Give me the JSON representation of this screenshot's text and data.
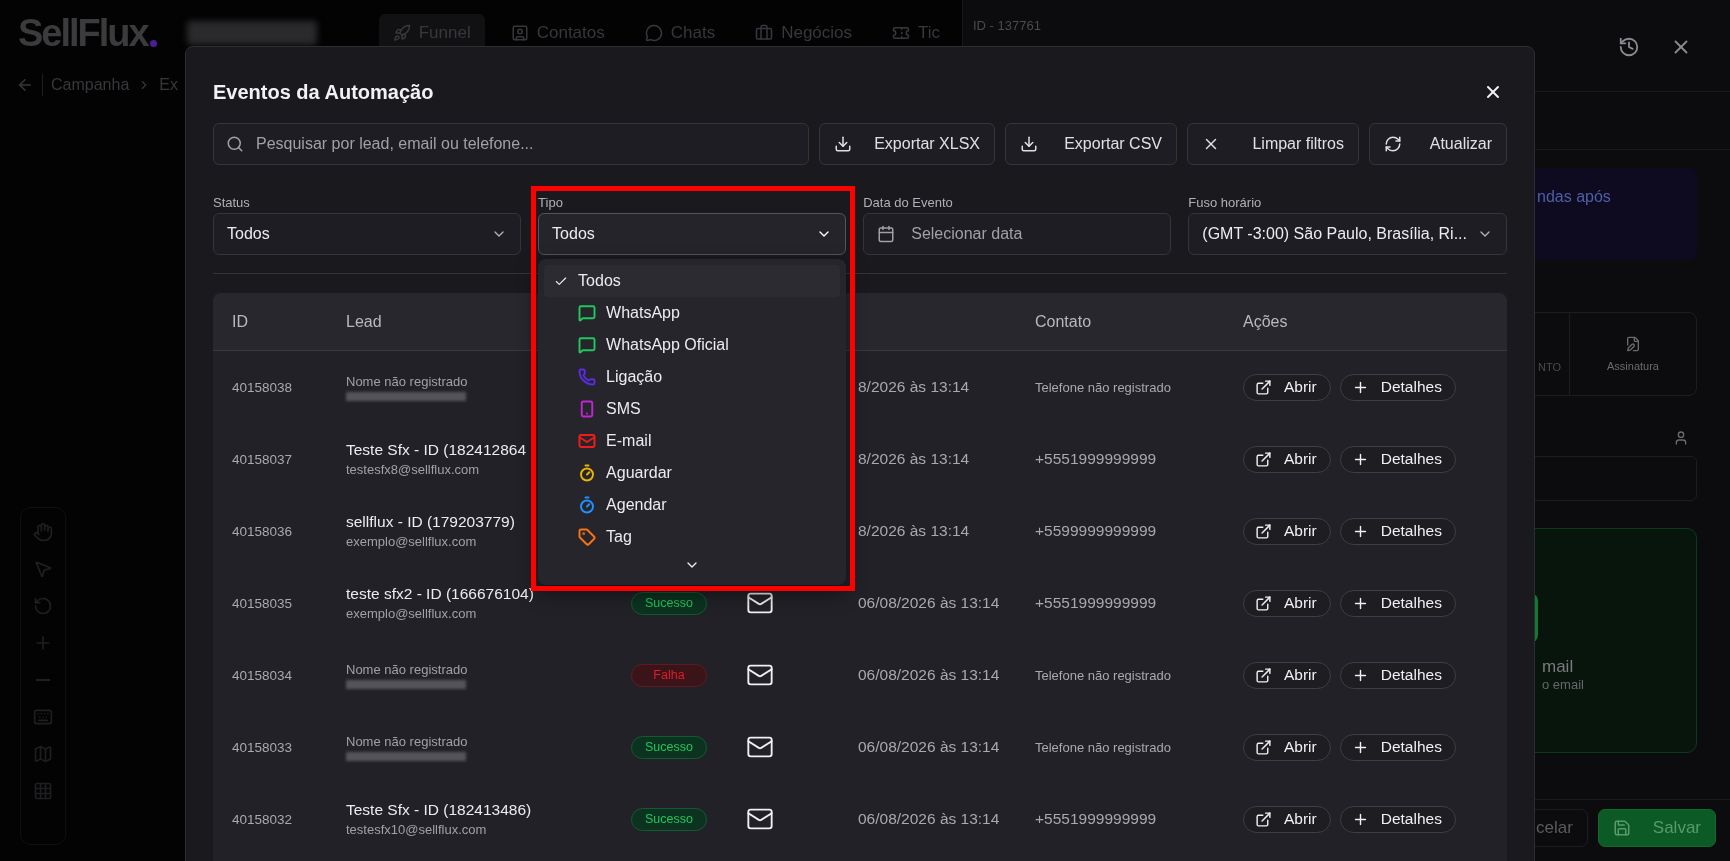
{
  "app": {
    "logo": "SellFlux",
    "nav": [
      {
        "label": "Funnel",
        "selected": true,
        "kind": "funnel"
      },
      {
        "label": "Contatos",
        "selected": false,
        "kind": "contacts"
      },
      {
        "label": "Chats",
        "selected": false,
        "kind": "chats"
      },
      {
        "label": "Negócios",
        "selected": false,
        "kind": "deals"
      },
      {
        "label": "Tic",
        "selected": false,
        "kind": "tickets"
      }
    ],
    "breadcrumb": [
      "Campanha",
      "Ex"
    ]
  },
  "side_panel": {
    "id_label": "ID - 137761",
    "banner_text": "ndas após",
    "option_cards": [
      "NTO",
      "Assinatura"
    ],
    "email_card": {
      "title": "mail",
      "subtitle": "o email"
    },
    "buttons": [
      {
        "label": "celar",
        "kind": "secondary"
      },
      {
        "label": "Salvar",
        "kind": "primary"
      }
    ]
  },
  "modal": {
    "title": "Eventos da Automação",
    "search": {
      "placeholder": "Pesquisar por lead, email ou telefone..."
    },
    "actions": [
      {
        "label": "Exportar XLSX",
        "kind": "download"
      },
      {
        "label": "Exportar CSV",
        "kind": "download"
      },
      {
        "label": "Limpar filtros",
        "kind": "clear"
      },
      {
        "label": "Atualizar",
        "kind": "refresh"
      }
    ],
    "filters": [
      {
        "label": "Status",
        "kind": "select",
        "value": "Todos",
        "expanded": false
      },
      {
        "label": "Tipo",
        "kind": "select",
        "value": "Todos",
        "expanded": true
      },
      {
        "label": "Data do Evento",
        "kind": "date",
        "placeholder": "Selecionar data"
      },
      {
        "label": "Fuso horário",
        "kind": "select",
        "value": "(GMT -3:00) São Paulo, Brasília, Ri...",
        "expanded": false
      }
    ],
    "type_menu": [
      {
        "label": "Todos",
        "kind": "all",
        "selected": true
      },
      {
        "label": "WhatsApp",
        "kind": "chat",
        "selected": false,
        "color": "#22c55e"
      },
      {
        "label": "WhatsApp Oficial",
        "kind": "chat",
        "selected": false,
        "color": "#22c55e"
      },
      {
        "label": "Ligação",
        "kind": "phone",
        "selected": false,
        "color": "#5b2be0"
      },
      {
        "label": "SMS",
        "kind": "sms",
        "selected": false,
        "color": "#c026d3"
      },
      {
        "label": "E-mail",
        "kind": "email",
        "selected": false,
        "color": "#ef1c1c"
      },
      {
        "label": "Aguardar",
        "kind": "wait",
        "selected": false,
        "color": "#eab308"
      },
      {
        "label": "Agendar",
        "kind": "schedule",
        "selected": false,
        "color": "#1e90ff"
      },
      {
        "label": "Tag",
        "kind": "tag",
        "selected": false,
        "color": "#f97316"
      }
    ],
    "table": {
      "header": {
        "id": "ID",
        "lead": "Lead",
        "contact": "Contato",
        "actions": "Ações"
      },
      "rows": [
        {
          "id": "40158038",
          "lead": "Nome não registrado",
          "lead_missing": true,
          "email_redacted": true,
          "date": "8/2026 às 13:14",
          "contact": "Telefone não registrado",
          "contact_missing": true,
          "actions": [
            {
              "label": "Abrir",
              "kind": "open"
            },
            {
              "label": "Detalhes",
              "kind": "details"
            }
          ]
        },
        {
          "id": "40158037",
          "lead": "Teste Sfx - ID (182412864",
          "lead_missing": false,
          "email": "testesfx8@sellflux.com",
          "date": "8/2026 às 13:14",
          "contact": "+5551999999999",
          "contact_missing": false,
          "actions": [
            {
              "label": "Abrir",
              "kind": "open"
            },
            {
              "label": "Detalhes",
              "kind": "details"
            }
          ]
        },
        {
          "id": "40158036",
          "lead": "sellflux - ID (179203779)",
          "lead_missing": false,
          "email": "exemplo@sellflux.com",
          "date": "8/2026 às 13:14",
          "contact": "+5599999999999",
          "contact_missing": false,
          "actions": [
            {
              "label": "Abrir",
              "kind": "open"
            },
            {
              "label": "Detalhes",
              "kind": "details"
            }
          ]
        },
        {
          "id": "40158035",
          "lead": "teste sfx2 - ID (166676104)",
          "lead_missing": false,
          "email": "exemplo@sellflux.com",
          "status": {
            "label": "Sucesso",
            "kind": "success"
          },
          "channel": {
            "kind": "email"
          },
          "date": "06/08/2026 às 13:14",
          "contact": "+5551999999999",
          "contact_missing": false,
          "actions": [
            {
              "label": "Abrir",
              "kind": "open"
            },
            {
              "label": "Detalhes",
              "kind": "details"
            }
          ]
        },
        {
          "id": "40158034",
          "lead": "Nome não registrado",
          "lead_missing": true,
          "email_redacted": true,
          "status": {
            "label": "Falha",
            "kind": "failure"
          },
          "channel": {
            "kind": "email"
          },
          "date": "06/08/2026 às 13:14",
          "contact": "Telefone não registrado",
          "contact_missing": true,
          "actions": [
            {
              "label": "Abrir",
              "kind": "open"
            },
            {
              "label": "Detalhes",
              "kind": "details"
            }
          ]
        },
        {
          "id": "40158033",
          "lead": "Nome não registrado",
          "lead_missing": true,
          "email_redacted": true,
          "status": {
            "label": "Sucesso",
            "kind": "success"
          },
          "channel": {
            "kind": "email"
          },
          "date": "06/08/2026 às 13:14",
          "contact": "Telefone não registrado",
          "contact_missing": true,
          "actions": [
            {
              "label": "Abrir",
              "kind": "open"
            },
            {
              "label": "Detalhes",
              "kind": "details"
            }
          ]
        },
        {
          "id": "40158032",
          "lead": "Teste Sfx - ID (182413486)",
          "lead_missing": false,
          "email": "testesfx10@sellflux.com",
          "status": {
            "label": "Sucesso",
            "kind": "success"
          },
          "channel": {
            "kind": "email"
          },
          "date": "06/08/2026 às 13:14",
          "contact": "+5551999999999",
          "contact_missing": false,
          "actions": [
            {
              "label": "Abrir",
              "kind": "open"
            },
            {
              "label": "Detalhes",
              "kind": "details"
            }
          ]
        }
      ]
    }
  }
}
